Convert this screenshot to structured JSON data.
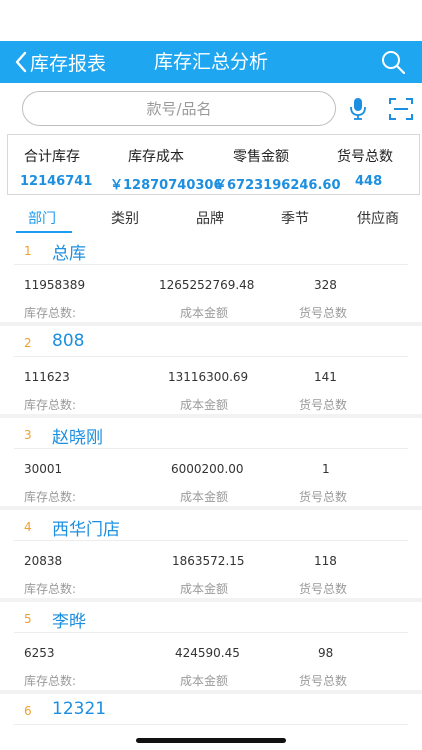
{
  "nav": {
    "back_label": "库存报表",
    "title": "库存汇总分析",
    "search_icon": "search-icon",
    "back_icon": "chevron-left-icon"
  },
  "search": {
    "placeholder": "款号/品名",
    "mic_icon": "microphone-icon",
    "scan_icon": "scan-icon"
  },
  "summary": {
    "labels": [
      "合计库存",
      "库存成本",
      "零售金额",
      "货号总数"
    ],
    "values": [
      "12146741",
      "￥12870740306",
      "￥6723196246.60",
      "448"
    ]
  },
  "tabs": {
    "items": [
      "部门",
      "类别",
      "品牌",
      "季节",
      "供应商"
    ],
    "active": "部门"
  },
  "list": {
    "items": [
      {
        "index": "1",
        "name": "总库",
        "stock": "11958389",
        "cost": "1265252769.48",
        "sku_count": "328",
        "stock_label": "库存总数:",
        "cost_label": "成本金额",
        "sku_label": "货号总数"
      },
      {
        "index": "2",
        "name": "808",
        "stock": "111623",
        "cost": "13116300.69",
        "sku_count": "141",
        "stock_label": "库存总数:",
        "cost_label": "成本金额",
        "sku_label": "货号总数"
      },
      {
        "index": "3",
        "name": "赵晓刚",
        "stock": "30001",
        "cost": "6000200.00",
        "sku_count": "1",
        "stock_label": "库存总数:",
        "cost_label": "成本金额",
        "sku_label": "货号总数"
      },
      {
        "index": "4",
        "name": "西华门店",
        "stock": "20838",
        "cost": "1863572.15",
        "sku_count": "118",
        "stock_label": "库存总数:",
        "cost_label": "成本金额",
        "sku_label": "货号总数"
      },
      {
        "index": "5",
        "name": "李晔",
        "stock": "6253",
        "cost": "424590.45",
        "sku_count": "98",
        "stock_label": "库存总数:",
        "cost_label": "成本金额",
        "sku_label": "货号总数"
      },
      {
        "index": "6",
        "name": "12321"
      }
    ]
  },
  "colors": {
    "nav_bg": "#1fa6f1",
    "accent": "#1d8fe0",
    "index": "#f0a030"
  }
}
